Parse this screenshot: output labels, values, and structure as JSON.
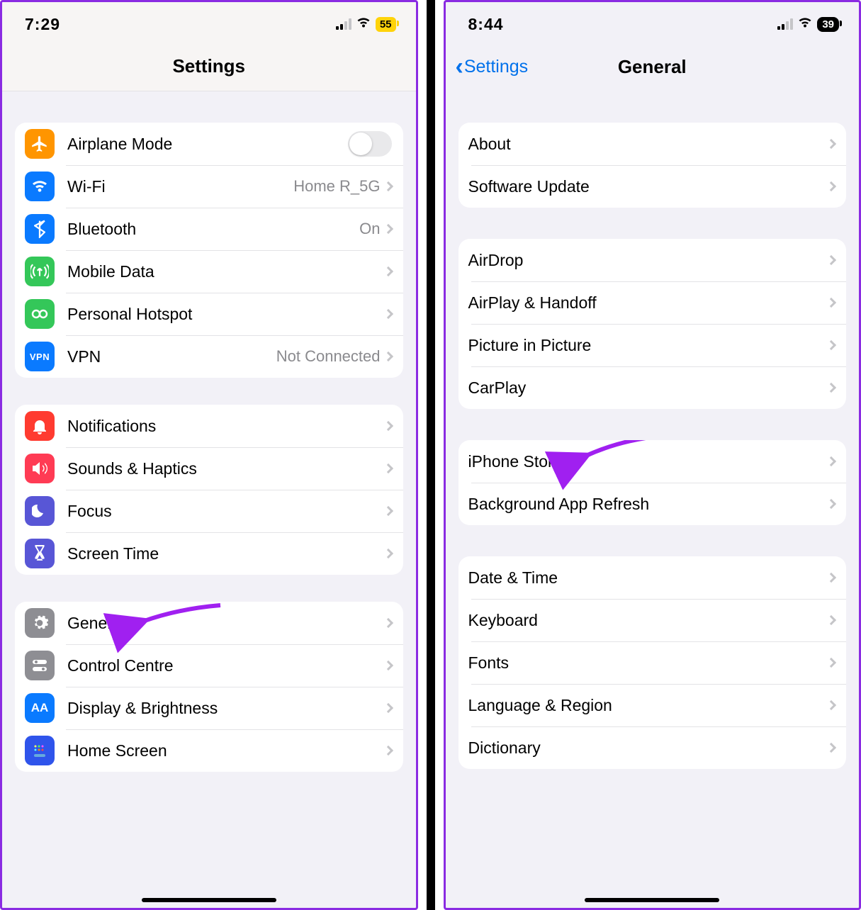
{
  "left": {
    "status": {
      "time": "7:29",
      "battery": "55"
    },
    "title": "Settings",
    "group1": [
      {
        "name": "airplane",
        "label": "Airplane Mode",
        "toggle": true
      },
      {
        "name": "wifi",
        "label": "Wi-Fi",
        "value": "Home R_5G"
      },
      {
        "name": "bluetooth",
        "label": "Bluetooth",
        "value": "On"
      },
      {
        "name": "mobile",
        "label": "Mobile Data"
      },
      {
        "name": "hotspot",
        "label": "Personal Hotspot"
      },
      {
        "name": "vpn",
        "label": "VPN",
        "value": "Not Connected"
      }
    ],
    "group2": [
      {
        "name": "notifications",
        "label": "Notifications"
      },
      {
        "name": "sounds",
        "label": "Sounds & Haptics"
      },
      {
        "name": "focus",
        "label": "Focus"
      },
      {
        "name": "screentime",
        "label": "Screen Time"
      }
    ],
    "group3": [
      {
        "name": "general",
        "label": "General"
      },
      {
        "name": "control",
        "label": "Control Centre"
      },
      {
        "name": "display",
        "label": "Display & Brightness"
      },
      {
        "name": "home",
        "label": "Home Screen"
      }
    ]
  },
  "right": {
    "status": {
      "time": "8:44",
      "battery": "39"
    },
    "back": "Settings",
    "title": "General",
    "group1": [
      {
        "name": "about",
        "label": "About"
      },
      {
        "name": "software-update",
        "label": "Software Update"
      }
    ],
    "group2": [
      {
        "name": "airdrop",
        "label": "AirDrop"
      },
      {
        "name": "airplay",
        "label": "AirPlay & Handoff"
      },
      {
        "name": "pip",
        "label": "Picture in Picture"
      },
      {
        "name": "carplay",
        "label": "CarPlay"
      }
    ],
    "group3": [
      {
        "name": "iphone-storage",
        "label": "iPhone Storage"
      },
      {
        "name": "bg-refresh",
        "label": "Background App Refresh"
      }
    ],
    "group4": [
      {
        "name": "date-time",
        "label": "Date & Time"
      },
      {
        "name": "keyboard",
        "label": "Keyboard"
      },
      {
        "name": "fonts",
        "label": "Fonts"
      },
      {
        "name": "language",
        "label": "Language & Region"
      },
      {
        "name": "dictionary",
        "label": "Dictionary"
      }
    ]
  }
}
